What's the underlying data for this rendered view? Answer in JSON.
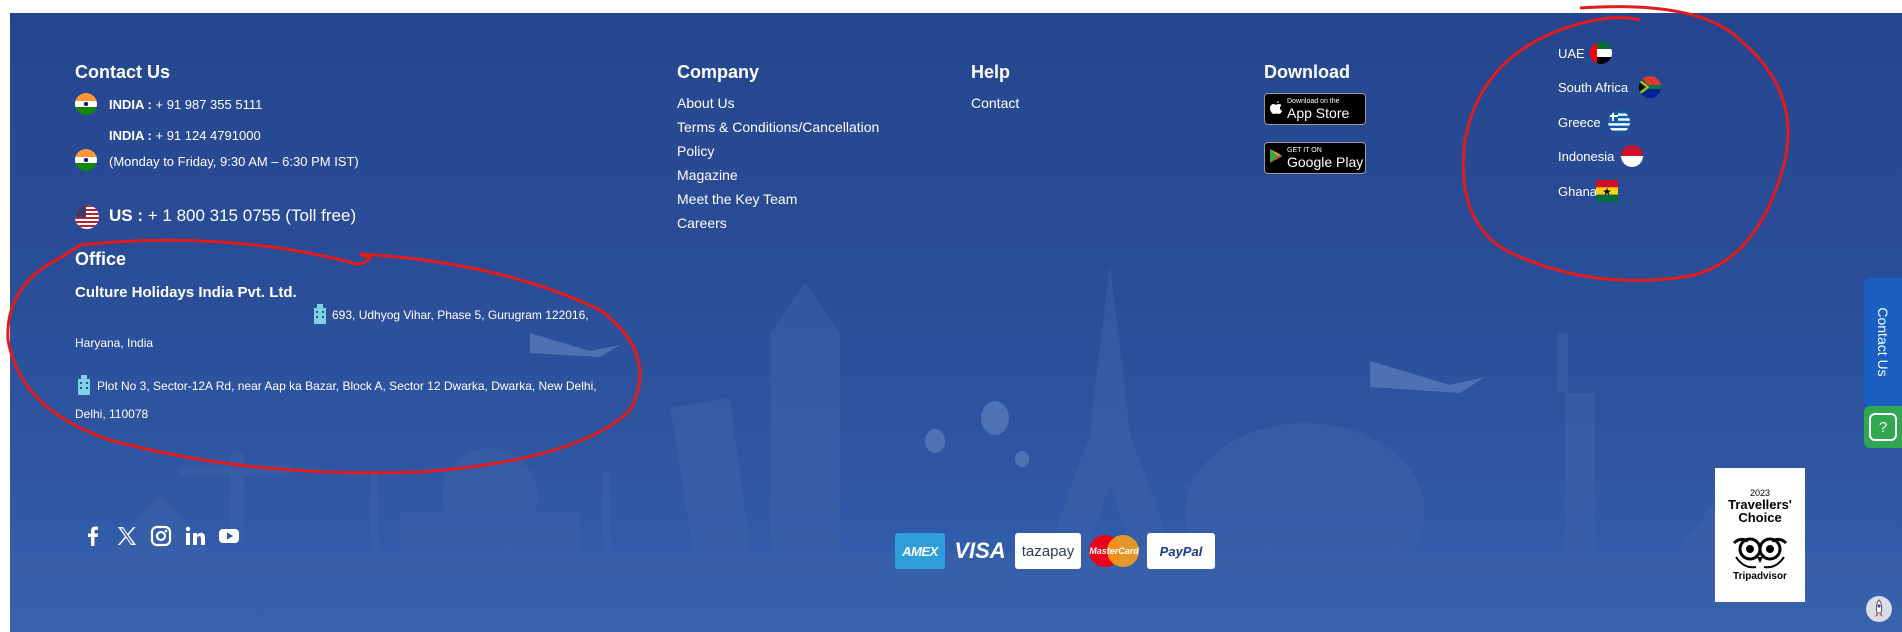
{
  "contact": {
    "heading": "Contact Us",
    "india1_label": "INDIA :",
    "india1_phone": "+ 91 987 355 5111",
    "india2_label": "INDIA :",
    "india2_phone": "+ 91 124 4791000",
    "hours": "(Monday to Friday, 9:30 AM – 6:30 PM IST)",
    "us_label": "US :",
    "us_phone": "+ 1 800 315 0755 (Toll free)"
  },
  "office": {
    "heading": "Office",
    "company": "Culture Holidays India Pvt. Ltd.",
    "address1_line1": "693, Udhyog Vihar, Phase 5, Gurugram 122016,",
    "address1_line2": "Haryana, India",
    "address2_line1": "Plot No 3, Sector-12A Rd, near Aap ka Bazar, Block A, Sector 12 Dwarka, Dwarka, New Delhi,",
    "address2_line2": "Delhi, 110078"
  },
  "company": {
    "heading": "Company",
    "links": [
      "About Us",
      "Terms & Conditions/Cancellation",
      "Policy",
      "Magazine",
      "Meet the Key Team",
      "Careers"
    ]
  },
  "help": {
    "heading": "Help",
    "links": [
      "Contact"
    ]
  },
  "download": {
    "heading": "Download",
    "appstore_small": "Download on the",
    "appstore_big": "App Store",
    "googleplay_small": "GET IT ON",
    "googleplay_big": "Google Play"
  },
  "countries": [
    "UAE",
    "South Africa",
    "Greece",
    "Indonesia",
    "Ghana"
  ],
  "payments": [
    "AMEX",
    "VISA",
    "tazapay",
    "MasterCard",
    "PayPal"
  ],
  "tripadvisor": {
    "year": "2023",
    "title_line1": "Travellers'",
    "title_line2": "Choice",
    "brand": "Tripadvisor"
  },
  "side_tab": {
    "label": "Contact Us"
  },
  "help_button": {
    "label": "?"
  },
  "social_icons": [
    "facebook-icon",
    "x-twitter-icon",
    "instagram-icon",
    "linkedin-icon",
    "youtube-icon"
  ],
  "colors": {
    "footer_bg": "#2b4e98",
    "annotation_red": "#e31b1b",
    "contact_tab": "#1a5fc2",
    "help_green": "#2fa84f"
  }
}
